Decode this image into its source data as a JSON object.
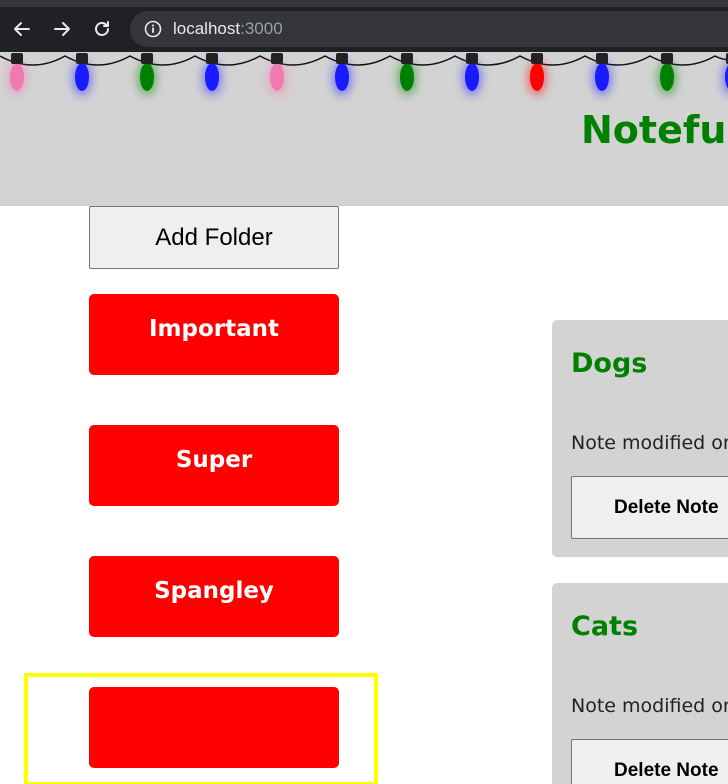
{
  "browser": {
    "url_host": "localhost",
    "url_port": ":3000"
  },
  "header": {
    "title": "Noteful",
    "light_colors": [
      "#f07ab0",
      "#1a1aff",
      "#008000",
      "#1a1aff",
      "#f07ab0",
      "#1a1aff",
      "#008000",
      "#1a1aff",
      "#ff0000",
      "#1a1aff",
      "#008000",
      "#1a1aff"
    ]
  },
  "sidebar": {
    "add_folder_label": "Add Folder",
    "folders": [
      {
        "label": "Important"
      },
      {
        "label": "Super"
      },
      {
        "label": "Spangley"
      },
      {
        "label": ""
      }
    ]
  },
  "notes": [
    {
      "title": "Dogs",
      "modified": "Note modified on",
      "delete_label": "Delete Note"
    },
    {
      "title": "Cats",
      "modified": "Note modified on",
      "delete_label": "Delete Note"
    }
  ],
  "colors": {
    "accent_green": "#008000",
    "folder_red": "#ff0000",
    "header_gray": "#d3d3d3",
    "focus_yellow": "#ffff00"
  }
}
